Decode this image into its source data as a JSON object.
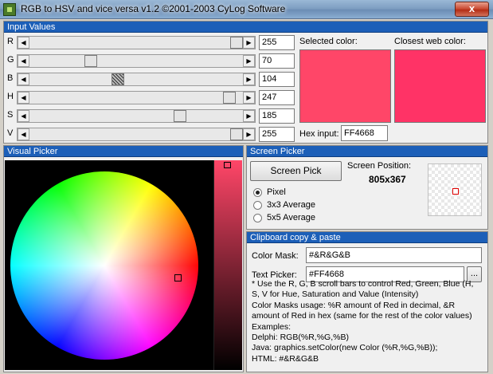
{
  "window": {
    "title": "RGB to HSV and vice versa v1.2 ©2001-2003 CyLog Software",
    "close_glyph": "x"
  },
  "input_values": {
    "heading": "Input Values",
    "sliders": [
      {
        "label": "R",
        "value": "255"
      },
      {
        "label": "G",
        "value": "70"
      },
      {
        "label": "B",
        "value": "104"
      },
      {
        "label": "H",
        "value": "247"
      },
      {
        "label": "S",
        "value": "185"
      },
      {
        "label": "V",
        "value": "255"
      }
    ],
    "slider_levels": {
      "R": 255,
      "G": 70,
      "B": 104,
      "H": 247,
      "S": 185,
      "V": 255,
      "max": 255
    },
    "selected_color_label": "Selected color:",
    "closest_web_color_label": "Closest web color:",
    "hex_input_label": "Hex input:",
    "hex_input_value": "FF4668",
    "colors": {
      "selected": "#FF4668",
      "closest_web": "#FF3366"
    }
  },
  "visual_picker": {
    "heading": "Visual Picker"
  },
  "screen_picker": {
    "heading": "Screen Picker",
    "button_label": "Screen Pick",
    "position_label": "Screen Position:",
    "position_value": "805x367",
    "options": [
      {
        "label": "Pixel",
        "selected": true
      },
      {
        "label": "3x3 Average",
        "selected": false
      },
      {
        "label": "5x5 Average",
        "selected": false
      }
    ]
  },
  "clipboard": {
    "heading": "Clipboard copy & paste",
    "color_mask_label": "Color Mask:",
    "color_mask_value": "#&R&G&B",
    "text_picker_label": "Text Picker:",
    "text_picker_value": "#FF4668",
    "browse_label": "...",
    "help_lines": [
      "* Use the R, G, B scroll bars to control Red, Green, Blue (H,",
      "S, V for Hue, Saturation and Value (Intensity)",
      "Color Masks usage: %R amount of Red in decimal, &R",
      "amount of Red in hex (same for the rest of the color values)",
      "Examples:",
      "Delphi:  RGB(%R,%G,%B)",
      "Java: graphics.setColor(new Color (%R,%G,%B));",
      "HTML: #&R&G&B"
    ]
  }
}
